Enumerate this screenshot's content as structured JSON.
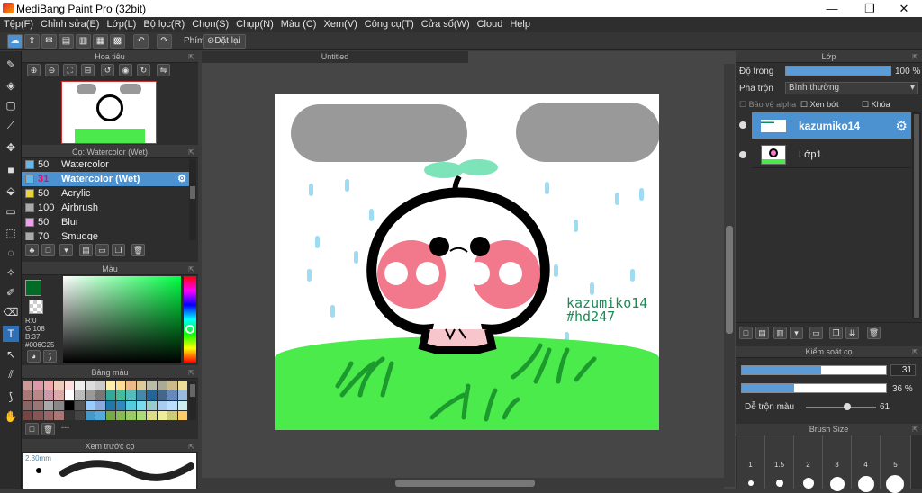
{
  "window": {
    "title": "MediBang Paint Pro (32bit)",
    "min": "—",
    "max": "❐",
    "close": "✕"
  },
  "menu": [
    "Tệp(F)",
    "Chỉnh sửa(E)",
    "Lớp(L)",
    "Bộ lọc(R)",
    "Chọn(S)",
    "Chụp(N)",
    "Màu (C)",
    "Xem(V)",
    "Công cụ(T)",
    "Cửa sổ(W)",
    "Cloud",
    "Help"
  ],
  "toolbar": {
    "shortcut_label": "Phím",
    "reset_label": "Đặt lại"
  },
  "navigator": {
    "title": "Hoa tiêu"
  },
  "brush_panel": {
    "title": "Cọ: Watercolor (Wet)",
    "items": [
      {
        "size": "50",
        "name": "Watercolor",
        "color": "#5fb8e8"
      },
      {
        "size": "31",
        "name": "Watercolor (Wet)",
        "color": "#5fb8e8"
      },
      {
        "size": "50",
        "name": "Acrylic",
        "color": "#e8d33a"
      },
      {
        "size": "100",
        "name": "Airbrush",
        "color": "#aaaaaa"
      },
      {
        "size": "50",
        "name": "Blur",
        "color": "#f0a0e8"
      },
      {
        "size": "70",
        "name": "Smudge",
        "color": "#aaaaaa"
      }
    ]
  },
  "color_panel": {
    "title": "Màu",
    "r": "R:0",
    "g": "G:108",
    "b": "B:37",
    "hex": "#006C25",
    "current": "#006c25"
  },
  "palette_panel": {
    "title": "Bảng màu",
    "dots": "---"
  },
  "preview_panel": {
    "title": "Xem trước cọ",
    "size": "2.30mm"
  },
  "canvas": {
    "tab_title": "Untitled",
    "signature_name": "kazumiko14",
    "signature_tag": "#hd247"
  },
  "layer_panel": {
    "title": "Lớp",
    "opacity_label": "Độ trong",
    "opacity_value": "100 %",
    "blend_label": "Pha trộn",
    "blend_value": "Bình thường",
    "protect_alpha": "Bảo vệ alpha",
    "clipping": "Xén bớt",
    "lock": "Khóa",
    "layers": [
      {
        "name": "kazumiko14",
        "selected": true
      },
      {
        "name": "Lớp1",
        "selected": false
      }
    ]
  },
  "brush_control": {
    "title": "Kiểm soát cọ",
    "size_value": "31",
    "opacity_value": "36 %",
    "mix_label": "Dễ trộn màu",
    "mix_value": "61",
    "size_fraction": 0.55,
    "opacity_fraction": 0.36
  },
  "brush_size_panel": {
    "title": "Brush Size",
    "sizes": [
      "1",
      "1.5",
      "2",
      "3",
      "4",
      "5"
    ]
  }
}
